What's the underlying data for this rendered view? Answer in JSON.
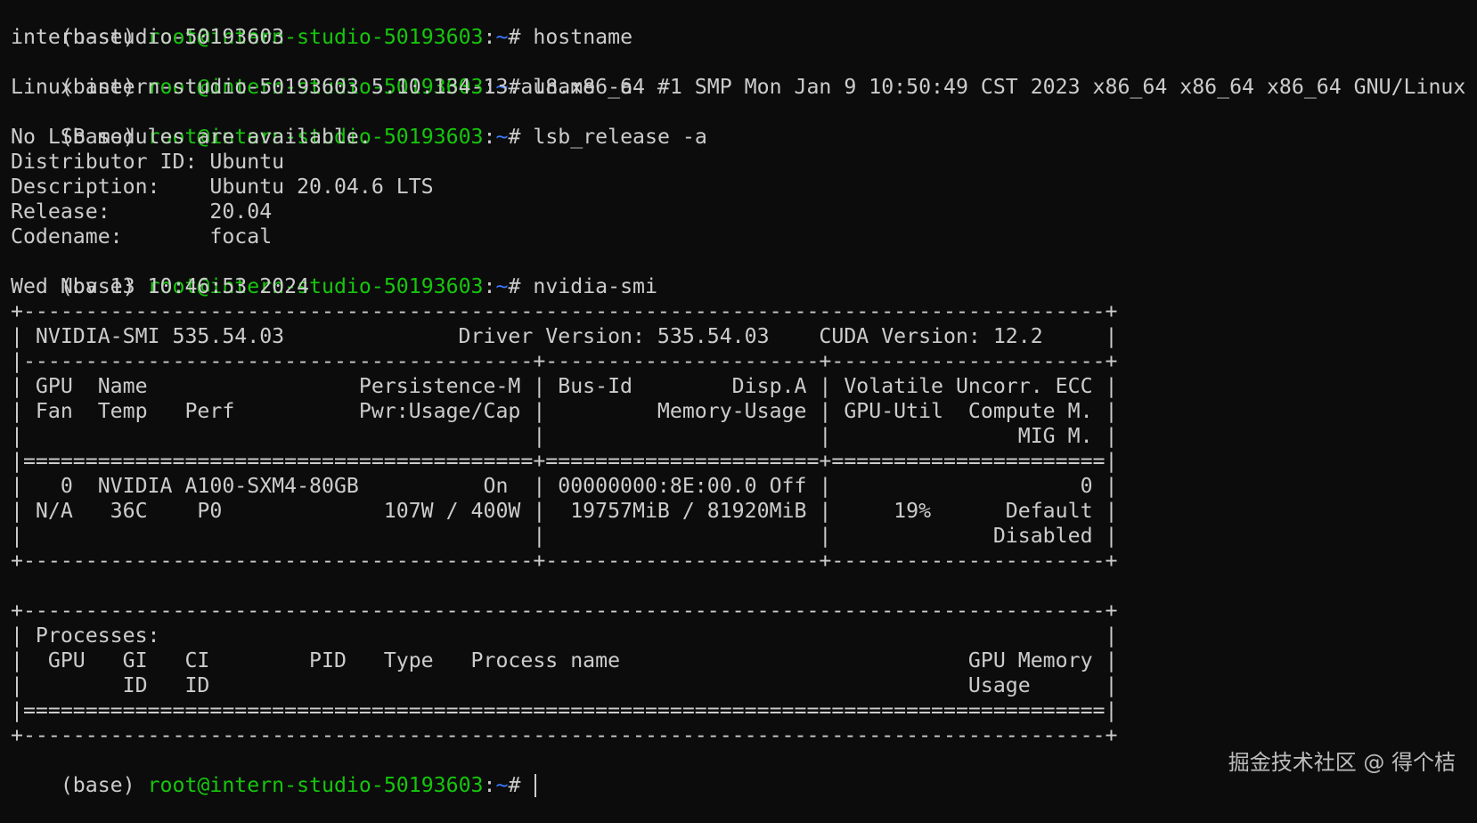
{
  "prompt": {
    "env": "(base)",
    "user_host": "root@intern-studio-50193603",
    "colon": ":",
    "path": "~",
    "hash": "#"
  },
  "commands": {
    "c1": "hostname",
    "c2": "uname -a",
    "c3": "lsb_release -a",
    "c4": "nvidia-smi"
  },
  "output": {
    "hostname": "intern-studio-50193603",
    "uname": "Linux intern-studio-50193603 5.10.134-13.al8.x86_64 #1 SMP Mon Jan 9 10:50:49 CST 2023 x86_64 x86_64 x86_64 GNU/Linux",
    "lsb": [
      "No LSB modules are available.",
      "Distributor ID: Ubuntu",
      "Description:    Ubuntu 20.04.6 LTS",
      "Release:        20.04",
      "Codename:       focal"
    ],
    "date": "Wed Nov 13 10:46:53 2024"
  },
  "smi": {
    "rows": [
      "+---------------------------------------------------------------------------------------+",
      "| NVIDIA-SMI 535.54.03              Driver Version: 535.54.03    CUDA Version: 12.2     |",
      "|-----------------------------------------+----------------------+----------------------+",
      "| GPU  Name                 Persistence-M | Bus-Id        Disp.A | Volatile Uncorr. ECC |",
      "| Fan  Temp   Perf          Pwr:Usage/Cap |         Memory-Usage | GPU-Util  Compute M. |",
      "|                                         |                      |               MIG M. |",
      "|=========================================+======================+======================|",
      "|   0  NVIDIA A100-SXM4-80GB          On  | 00000000:8E:00.0 Off |                    0 |",
      "| N/A   36C    P0             107W / 400W |  19757MiB / 81920MiB |     19%      Default |",
      "|                                         |                      |             Disabled |",
      "+-----------------------------------------+----------------------+----------------------+",
      "",
      "+---------------------------------------------------------------------------------------+",
      "| Processes:                                                                            |",
      "|  GPU   GI   CI        PID   Type   Process name                            GPU Memory |",
      "|        ID   ID                                                             Usage      |",
      "|=======================================================================================|",
      "+---------------------------------------------------------------------------------------+"
    ]
  },
  "watermark": "掘金技术社区 @ 得个桔"
}
